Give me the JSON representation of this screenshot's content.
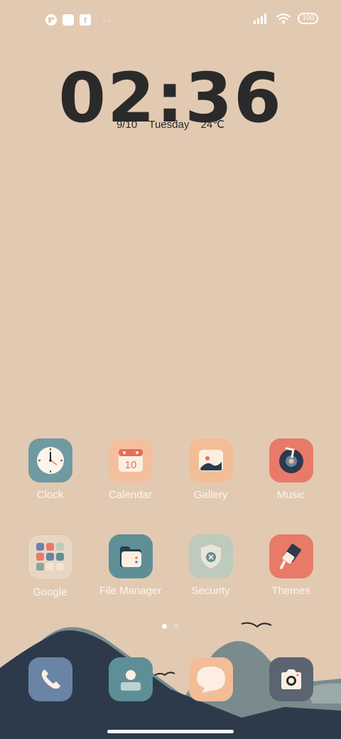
{
  "status_bar": {
    "left_icons": [
      "notification-icon",
      "square-icon",
      "upload-icon"
    ],
    "more": "··",
    "battery": "100"
  },
  "clock": {
    "time": "02:36",
    "date": "9/10",
    "weekday": "Tuesday",
    "temperature": "24℃"
  },
  "apps": [
    {
      "label": "Clock",
      "icon": "clock-icon",
      "color": "#6f9aa1"
    },
    {
      "label": "Calendar",
      "icon": "calendar-icon",
      "color": "#f4bf9c",
      "badge": "10"
    },
    {
      "label": "Gallery",
      "icon": "gallery-icon",
      "color": "#f3bd97"
    },
    {
      "label": "Music",
      "icon": "music-icon",
      "color": "#e97a68"
    },
    {
      "label": "Google",
      "icon": "google-folder-icon",
      "color": "#e7d6c3"
    },
    {
      "label": "File Manager",
      "icon": "folder-icon",
      "color": "#5f8f96"
    },
    {
      "label": "Security",
      "icon": "shield-icon",
      "color": "#bdcabc"
    },
    {
      "label": "Themes",
      "icon": "paint-roller-icon",
      "color": "#e97a68"
    }
  ],
  "pages": {
    "count": 2,
    "active": 1
  },
  "dock": [
    {
      "name": "phone",
      "icon": "phone-icon",
      "color": "#6a84a6"
    },
    {
      "name": "contacts",
      "icon": "contacts-icon",
      "color": "#5f8f96"
    },
    {
      "name": "messages",
      "icon": "message-icon",
      "color": "#f3bd97"
    },
    {
      "name": "camera",
      "icon": "camera-icon",
      "color": "#5b6470"
    }
  ]
}
